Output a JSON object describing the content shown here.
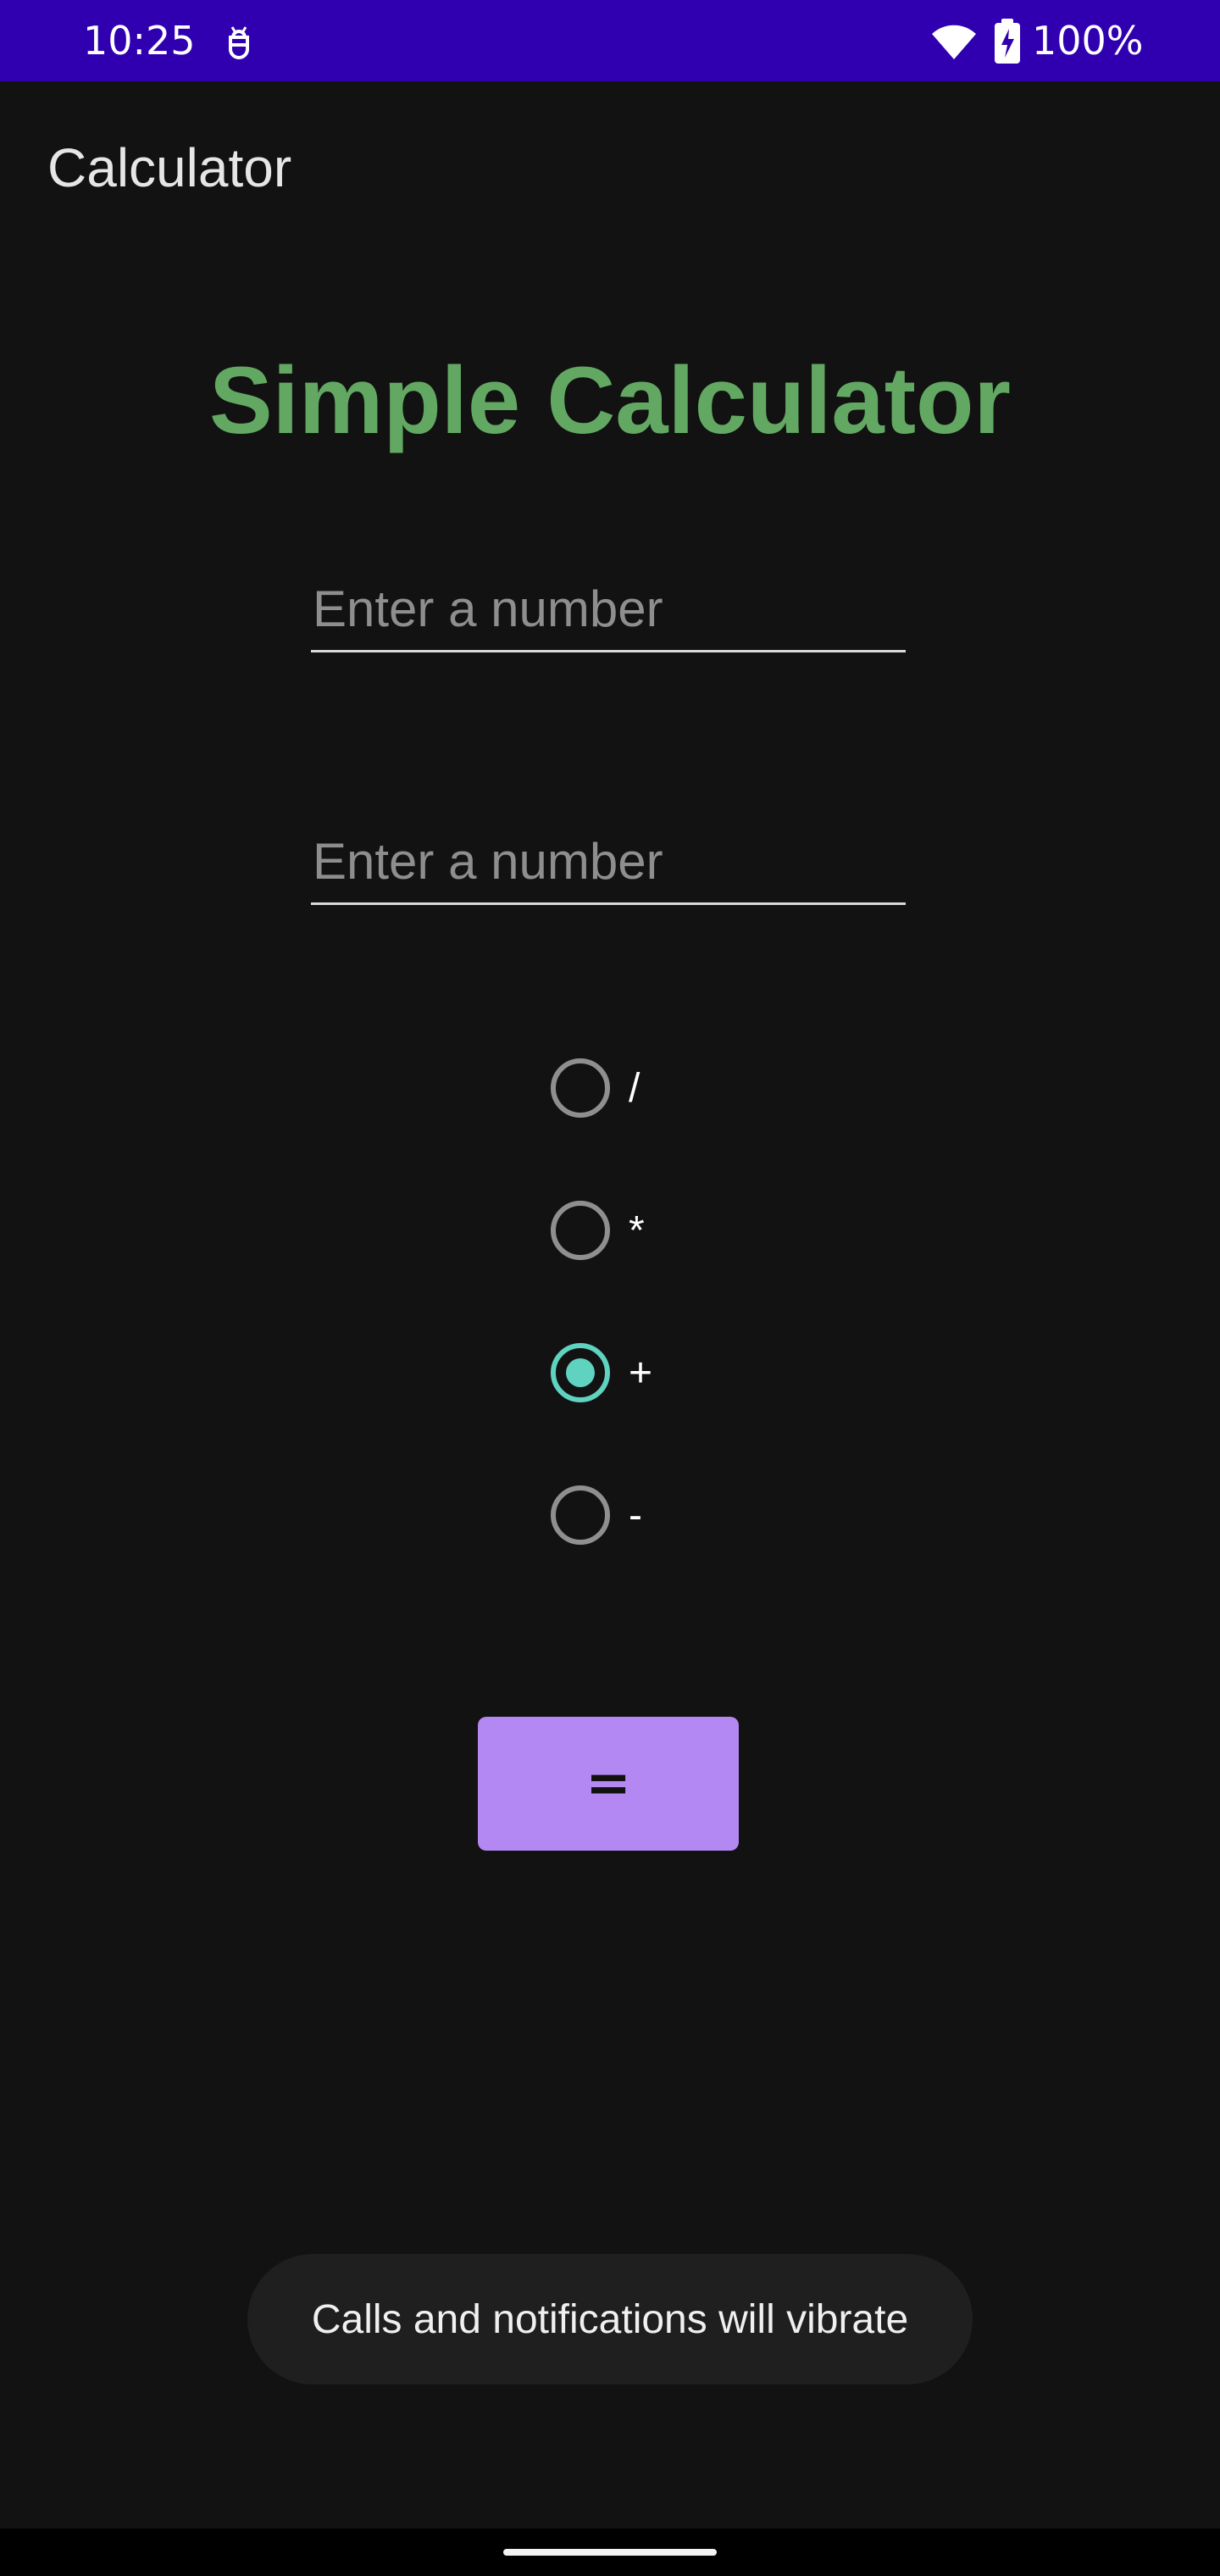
{
  "status_bar": {
    "time": "10:25",
    "battery": "100%",
    "icons": [
      "debug-icon",
      "wifi-icon",
      "battery-charging-icon"
    ],
    "background_color": "#3000b0"
  },
  "app_bar": {
    "title": "Calculator"
  },
  "main": {
    "heading": "Simple Calculator",
    "heading_color": "#62a862",
    "inputs": [
      {
        "value": "",
        "placeholder": "Enter a number"
      },
      {
        "value": "",
        "placeholder": "Enter a number"
      }
    ],
    "operators": [
      {
        "label": "/",
        "checked": false
      },
      {
        "label": "*",
        "checked": false
      },
      {
        "label": "+",
        "checked": true
      },
      {
        "label": "-",
        "checked": false
      }
    ],
    "selected_operator": "+",
    "equals_label": "=",
    "button_color": "#b388f2",
    "radio_accent_color": "#5fd3c0"
  },
  "toast": {
    "message": "Calls and notifications will vibrate"
  }
}
